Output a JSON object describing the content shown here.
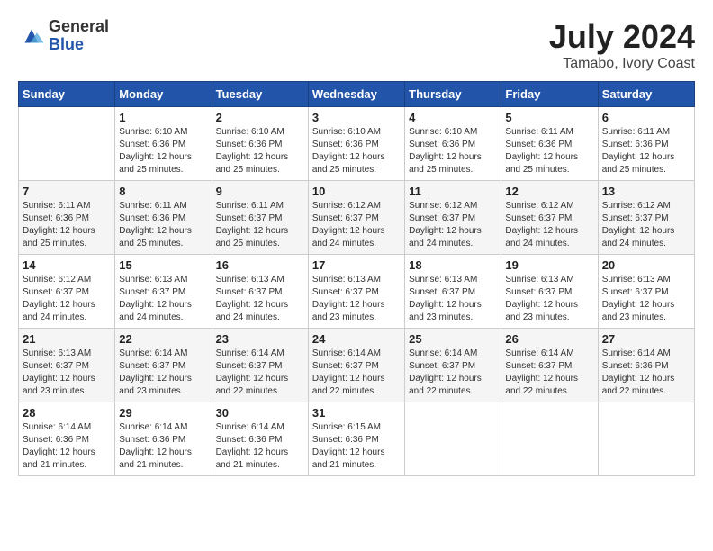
{
  "logo": {
    "general": "General",
    "blue": "Blue"
  },
  "title": "July 2024",
  "location": "Tamabo, Ivory Coast",
  "days_of_week": [
    "Sunday",
    "Monday",
    "Tuesday",
    "Wednesday",
    "Thursday",
    "Friday",
    "Saturday"
  ],
  "weeks": [
    [
      {
        "day": "",
        "info": ""
      },
      {
        "day": "1",
        "info": "Sunrise: 6:10 AM\nSunset: 6:36 PM\nDaylight: 12 hours\nand 25 minutes."
      },
      {
        "day": "2",
        "info": "Sunrise: 6:10 AM\nSunset: 6:36 PM\nDaylight: 12 hours\nand 25 minutes."
      },
      {
        "day": "3",
        "info": "Sunrise: 6:10 AM\nSunset: 6:36 PM\nDaylight: 12 hours\nand 25 minutes."
      },
      {
        "day": "4",
        "info": "Sunrise: 6:10 AM\nSunset: 6:36 PM\nDaylight: 12 hours\nand 25 minutes."
      },
      {
        "day": "5",
        "info": "Sunrise: 6:11 AM\nSunset: 6:36 PM\nDaylight: 12 hours\nand 25 minutes."
      },
      {
        "day": "6",
        "info": "Sunrise: 6:11 AM\nSunset: 6:36 PM\nDaylight: 12 hours\nand 25 minutes."
      }
    ],
    [
      {
        "day": "7",
        "info": ""
      },
      {
        "day": "8",
        "info": "Sunrise: 6:11 AM\nSunset: 6:36 PM\nDaylight: 12 hours\nand 25 minutes."
      },
      {
        "day": "9",
        "info": "Sunrise: 6:11 AM\nSunset: 6:37 PM\nDaylight: 12 hours\nand 25 minutes."
      },
      {
        "day": "10",
        "info": "Sunrise: 6:12 AM\nSunset: 6:37 PM\nDaylight: 12 hours\nand 24 minutes."
      },
      {
        "day": "11",
        "info": "Sunrise: 6:12 AM\nSunset: 6:37 PM\nDaylight: 12 hours\nand 24 minutes."
      },
      {
        "day": "12",
        "info": "Sunrise: 6:12 AM\nSunset: 6:37 PM\nDaylight: 12 hours\nand 24 minutes."
      },
      {
        "day": "13",
        "info": "Sunrise: 6:12 AM\nSunset: 6:37 PM\nDaylight: 12 hours\nand 24 minutes."
      }
    ],
    [
      {
        "day": "14",
        "info": ""
      },
      {
        "day": "15",
        "info": "Sunrise: 6:13 AM\nSunset: 6:37 PM\nDaylight: 12 hours\nand 24 minutes."
      },
      {
        "day": "16",
        "info": "Sunrise: 6:13 AM\nSunset: 6:37 PM\nDaylight: 12 hours\nand 24 minutes."
      },
      {
        "day": "17",
        "info": "Sunrise: 6:13 AM\nSunset: 6:37 PM\nDaylight: 12 hours\nand 23 minutes."
      },
      {
        "day": "18",
        "info": "Sunrise: 6:13 AM\nSunset: 6:37 PM\nDaylight: 12 hours\nand 23 minutes."
      },
      {
        "day": "19",
        "info": "Sunrise: 6:13 AM\nSunset: 6:37 PM\nDaylight: 12 hours\nand 23 minutes."
      },
      {
        "day": "20",
        "info": "Sunrise: 6:13 AM\nSunset: 6:37 PM\nDaylight: 12 hours\nand 23 minutes."
      }
    ],
    [
      {
        "day": "21",
        "info": ""
      },
      {
        "day": "22",
        "info": "Sunrise: 6:14 AM\nSunset: 6:37 PM\nDaylight: 12 hours\nand 23 minutes."
      },
      {
        "day": "23",
        "info": "Sunrise: 6:14 AM\nSunset: 6:37 PM\nDaylight: 12 hours\nand 22 minutes."
      },
      {
        "day": "24",
        "info": "Sunrise: 6:14 AM\nSunset: 6:37 PM\nDaylight: 12 hours\nand 22 minutes."
      },
      {
        "day": "25",
        "info": "Sunrise: 6:14 AM\nSunset: 6:37 PM\nDaylight: 12 hours\nand 22 minutes."
      },
      {
        "day": "26",
        "info": "Sunrise: 6:14 AM\nSunset: 6:37 PM\nDaylight: 12 hours\nand 22 minutes."
      },
      {
        "day": "27",
        "info": "Sunrise: 6:14 AM\nSunset: 6:36 PM\nDaylight: 12 hours\nand 22 minutes."
      }
    ],
    [
      {
        "day": "28",
        "info": "Sunrise: 6:14 AM\nSunset: 6:36 PM\nDaylight: 12 hours\nand 21 minutes."
      },
      {
        "day": "29",
        "info": "Sunrise: 6:14 AM\nSunset: 6:36 PM\nDaylight: 12 hours\nand 21 minutes."
      },
      {
        "day": "30",
        "info": "Sunrise: 6:14 AM\nSunset: 6:36 PM\nDaylight: 12 hours\nand 21 minutes."
      },
      {
        "day": "31",
        "info": "Sunrise: 6:15 AM\nSunset: 6:36 PM\nDaylight: 12 hours\nand 21 minutes."
      },
      {
        "day": "",
        "info": ""
      },
      {
        "day": "",
        "info": ""
      },
      {
        "day": "",
        "info": ""
      }
    ]
  ],
  "week_sundays": {
    "7": "Sunrise: 6:11 AM\nSunset: 6:36 PM\nDaylight: 12 hours\nand 25 minutes.",
    "14": "Sunrise: 6:12 AM\nSunset: 6:37 PM\nDaylight: 12 hours\nand 24 minutes.",
    "21": "Sunrise: 6:13 AM\nSunset: 6:37 PM\nDaylight: 12 hours\nand 23 minutes."
  }
}
